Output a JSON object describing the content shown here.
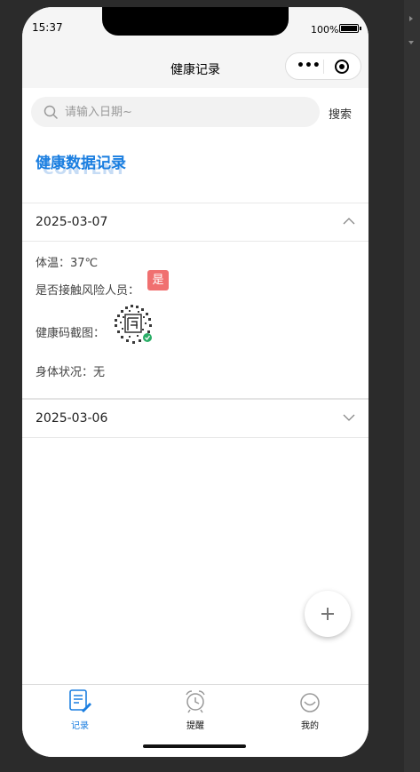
{
  "status_bar": {
    "time": "15:37",
    "battery": "100%"
  },
  "nav": {
    "title": "健康记录",
    "more_icon": "more-dots-icon",
    "close_icon": "target-icon"
  },
  "search": {
    "placeholder": "请输入日期~",
    "button": "搜索"
  },
  "section": {
    "title": "健康数据记录",
    "bg_text": "CONTENT"
  },
  "records": [
    {
      "date": "2025-03-07",
      "expanded": true,
      "temperature_label": "体温：",
      "temperature_value": "37℃",
      "contact_label": "是否接触风险人员：",
      "contact_value": "是",
      "code_label": "健康码截图：",
      "condition_label": "身体状况：",
      "condition_value": "无"
    },
    {
      "date": "2025-03-06",
      "expanded": false
    }
  ],
  "tabs": [
    {
      "label": "记录",
      "icon": "record-icon",
      "active": true
    },
    {
      "label": "提醒",
      "icon": "alarm-clock-icon",
      "active": false
    },
    {
      "label": "我的",
      "icon": "smile-icon",
      "active": false
    }
  ],
  "colors": {
    "accent": "#1a7ee0",
    "badge": "#f07070",
    "bg_text": "#c6dcf5"
  }
}
